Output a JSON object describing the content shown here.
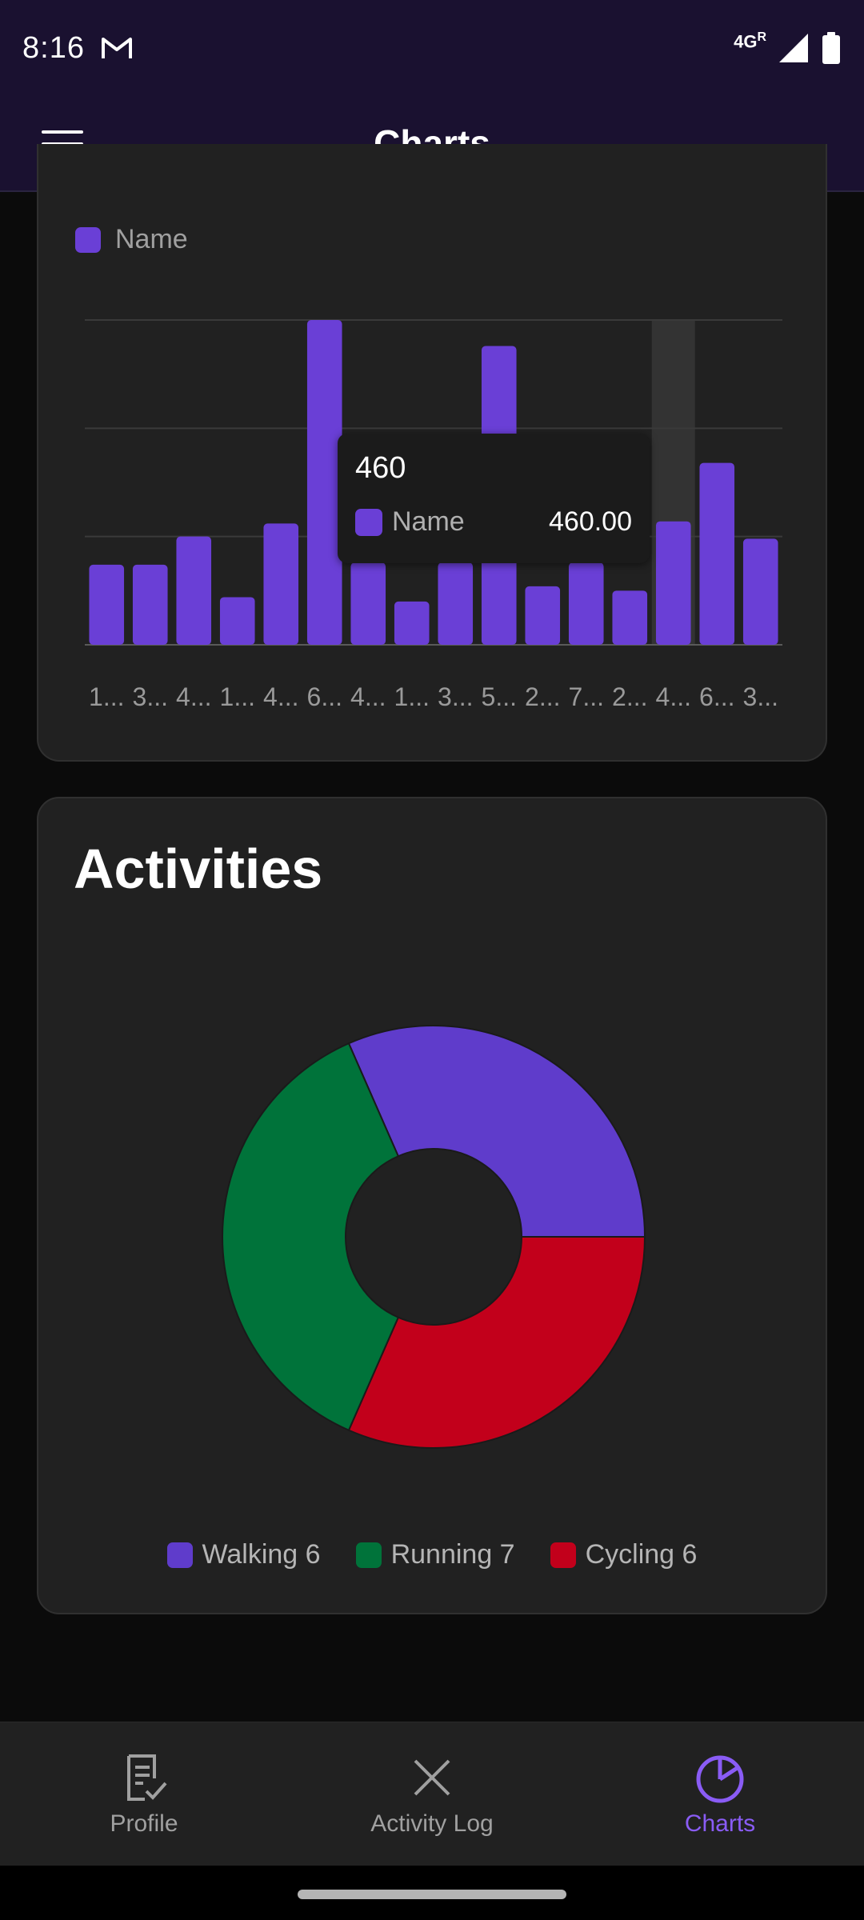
{
  "status_bar": {
    "time": "8:16",
    "network": "4G",
    "network_sup": "R"
  },
  "app_bar": {
    "title": "Charts"
  },
  "bar_card": {
    "legend_label": "Name",
    "tooltip": {
      "title": "460",
      "series_name": "Name",
      "value": "460.00"
    }
  },
  "pie_card": {
    "title": "Activities",
    "legend": [
      {
        "label": "Walking 6"
      },
      {
        "label": "Running 7"
      },
      {
        "label": "Cycling 6"
      }
    ]
  },
  "bottom_nav": {
    "items": [
      {
        "label": "Profile",
        "icon": "profile-icon"
      },
      {
        "label": "Activity Log",
        "icon": "close-x-icon"
      },
      {
        "label": "Charts",
        "icon": "pie-chart-icon"
      }
    ],
    "active": "Charts"
  },
  "colors": {
    "accent": "#6a3fd6",
    "walking": "#5f3ccb",
    "running": "#00733a",
    "cycling": "#c2001b",
    "app_bar": "#1a1130"
  },
  "chart_data": [
    {
      "type": "bar",
      "categories": [
        "1...",
        "3...",
        "4...",
        "1...",
        "4...",
        "6...",
        "4...",
        "1...",
        "3...",
        "5...",
        "2...",
        "7...",
        "2...",
        "4...",
        "6...",
        "3..."
      ],
      "series": [
        {
          "name": "Name",
          "values": [
            185,
            185,
            250,
            110,
            280,
            750,
            190,
            100,
            190,
            690,
            135,
            190,
            125,
            285,
            420,
            245
          ]
        }
      ],
      "ylim": [
        0,
        750
      ],
      "grid": true,
      "legend": "top-left",
      "highlighted_index": 13,
      "tooltip_value": 460
    },
    {
      "type": "pie",
      "title": "Activities",
      "labels": [
        "Walking",
        "Running",
        "Cycling"
      ],
      "values": [
        6,
        7,
        6
      ],
      "donut": true,
      "legend": "bottom"
    }
  ]
}
